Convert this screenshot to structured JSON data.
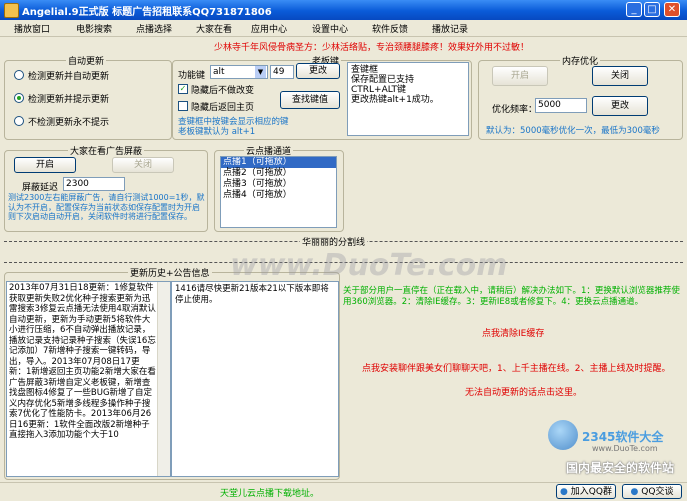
{
  "window": {
    "title": "Angelial.9正式版   标题广告招租联系QQ731871806",
    "minimize": "_",
    "maximize": "□",
    "close": "✕"
  },
  "menu": [
    "播放窗口",
    "电影搜索",
    "点播选择",
    "大家在看",
    "应用中心",
    "设置中心",
    "软件反馈",
    "播放记录"
  ],
  "banner": "少林寺千年风侵骨病圣方：少林活络贴，专治颈腰腿膝疼！效果好外用不过敏！",
  "auto_update": {
    "title": "自动更新",
    "options": [
      "检测更新并自动更新",
      "检测更新并提示更新",
      "不检测更新永不提示"
    ],
    "selected_index": 1
  },
  "boss_key": {
    "title": "老板键",
    "hotkey_label": "功能键",
    "modifier": "alt",
    "key_value": "49",
    "change_button": "更改",
    "hide_label": "隐藏后不做改变",
    "hide_checked": true,
    "return_home_label": "隐藏后返回主页",
    "return_home_checked": false,
    "find_button": "查找键值",
    "hint": "查键框中按键会显示相应的键\n老板键默认为 alt+1",
    "log": [
      "查键框",
      "保存配置已支持",
      "CTRL+ALT键",
      "更改热键alt+1成功。"
    ]
  },
  "memory": {
    "title": "内存优化",
    "start_button": "开启",
    "close_button": "关闭",
    "freq_label": "优化频率：",
    "freq_value": "5000",
    "change_button": "更改",
    "note": "默认为：5000毫秒优化一次，最低为300毫秒"
  },
  "ad_block": {
    "title": "大家在看广告屏蔽",
    "start_button": "开启",
    "close_button": "关闭",
    "delay_label": "屏蔽延迟",
    "delay_value": "2300",
    "note": "测试2300左右能屏蔽广告，请自行测试1000=1秒，默认为不开启，配置保存为当前状态如保存配置时为开启则下次启动自动开启，关闭软件时将进行配置保存。"
  },
  "channels": {
    "title": "云点播通道",
    "items": [
      "点播1（可拖放）",
      "点播2（可拖放）",
      "点播3（可拖放）",
      "点播4（可拖放）"
    ],
    "selected_index": 0
  },
  "divider_label": "华丽丽的分割线",
  "history": {
    "title": "更新历史+公告信息",
    "text": "2013年07月31日18更新：1修复软件获取更新失败2优化种子搜索更新为迅雷搜索3修复云点播无法使用4取消默认自动更新，更新为手动更新5将软件大小进行压缩，6不自动弹出播放记录，播放记录支持记录种子搜索（失误16忘记添加）7新增种子搜索一键转码，导出，导入。2013年07月08日17更新：1新增返回主页功能2新增大家在看广告屏蔽3新增自定义老板键，新增查找盘图标4修复了一些BUG新增了自定义内存优化5新增多线程多操作种子搜索7优化了性能防卡。2013年06月26日16更新：1软件全面改版2新增种子直接拖入3添加功能个大于10",
    "notice": "1416请尽快更新21版本21以下版本即将停止使用。"
  },
  "tips": {
    "green": "关于部分用户一直停在（正在载入中，请稍后）解决办法如下。1：更换默认浏览器推荐使用360浏览器。2：清除IE缓存。3：更新IE8或者修复下。4：更换云点播通道。",
    "clear_ie": "点我清除IE缓存",
    "red": "点我安装聊伴跟美女们聊聊天吧，1、上千主播在线。2、主播上线及时提醒。",
    "manual": "无法自动更新的话点击这里。"
  },
  "watermark": {
    "logo": "2345软件大全",
    "url": "www.DuoTe.com",
    "slogan": "国内最安全的软件站",
    "center": "www.DuoTe.com"
  },
  "status": {
    "text": "天堂儿云点播下载地址。",
    "qq_group": "加入QQ群",
    "qq_chat": "QQ交谈"
  },
  "colors": {
    "titlebar": "#0a5bd8",
    "accent_red": "#e00000",
    "accent_green": "#00b000",
    "accent_blue": "#1a75c8"
  }
}
